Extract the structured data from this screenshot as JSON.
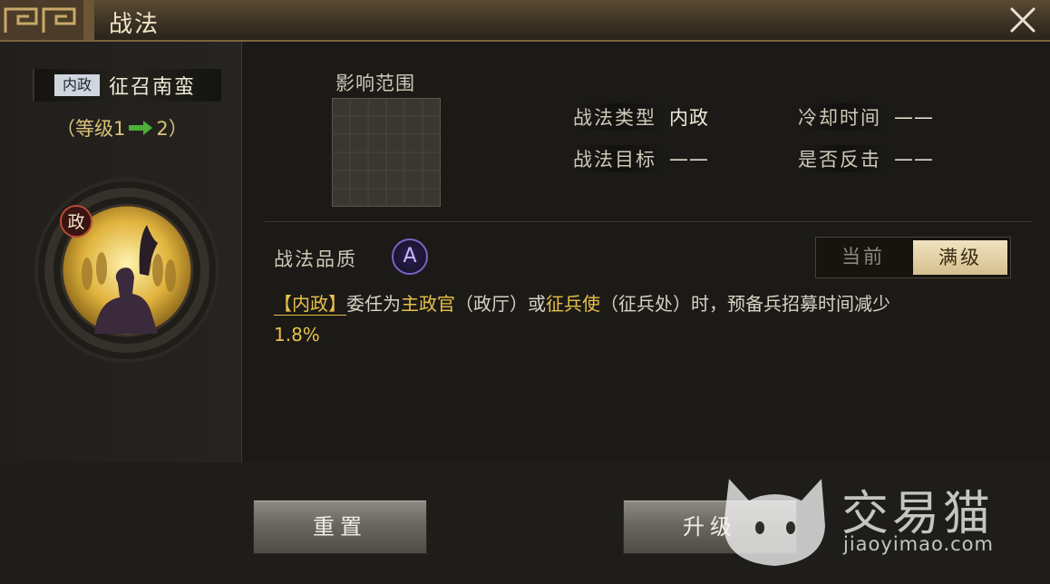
{
  "window": {
    "title": "战法"
  },
  "skill": {
    "type_tag": "内政",
    "name": "征召南蛮",
    "level_open": "（等级1",
    "level_close": "2）",
    "portrait_badge": "政"
  },
  "range": {
    "label": "影响范围"
  },
  "info": {
    "type_label": "战法类型",
    "type_value": "内政",
    "cooldown_label": "冷却时间",
    "cooldown_value": "——",
    "target_label": "战法目标",
    "target_value": "——",
    "counter_label": "是否反击",
    "counter_value": "——"
  },
  "quality": {
    "label": "战法品质",
    "grade": "A"
  },
  "toggle": {
    "current": "当前",
    "max": "满级",
    "selected": "max"
  },
  "description": {
    "tag": "【内政】",
    "part1": "委任为",
    "highlight1": "主政官",
    "part2": "（政厅）或",
    "highlight2": "征兵使",
    "part3": "（征兵处）时，预备兵招募时间减少",
    "value": "1.8%"
  },
  "buttons": {
    "reset": "重置",
    "upgrade": "升级"
  },
  "watermark": {
    "brand": "交易猫",
    "url": "jiaoyimao.com"
  },
  "colors": {
    "accent_gold": "#e8c04a",
    "quality_purple": "#7b62c8",
    "level_arrow": "#4caf3a"
  }
}
